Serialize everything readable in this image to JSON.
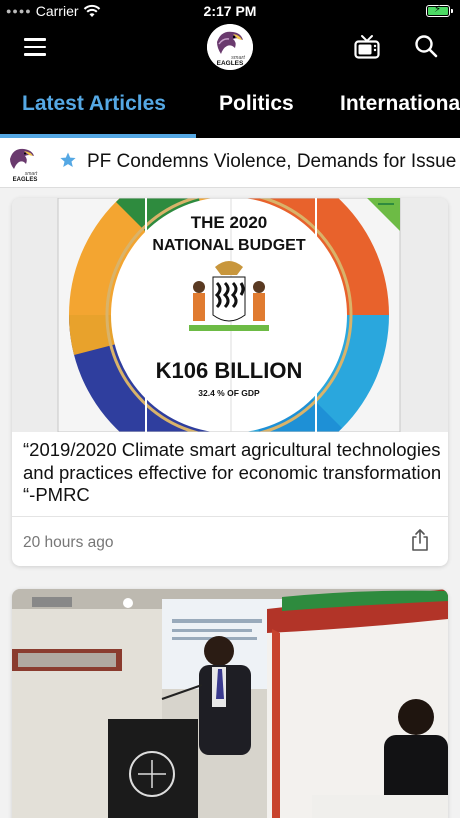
{
  "status_bar": {
    "carrier": "Carrier",
    "time": "2:17 PM"
  },
  "header": {
    "logo_small_text": "smart",
    "logo_text": "EAGLES",
    "icons": [
      "menu-icon",
      "tv-icon",
      "search-icon"
    ]
  },
  "tabs": [
    {
      "label": "Latest Articles",
      "active": true
    },
    {
      "label": "Politics",
      "active": false
    },
    {
      "label": "Internationa",
      "active": false
    }
  ],
  "ticker": {
    "text": "PF Condemns Violence, Demands for Issue B"
  },
  "articles": [
    {
      "image": {
        "line1": "THE 2020",
        "line2": "NATIONAL BUDGET",
        "amount": "K106 BILLION",
        "note": "32.4 % OF GDP"
      },
      "title": "“2019/2020 Climate smart agricultural technologies and practices effective for economic transformation “-PMRC",
      "time": "20 hours ago"
    },
    {
      "image": {}
    }
  ],
  "colors": {
    "accent": "#55a8e4",
    "header_bg": "#000000",
    "battery": "#4cd964"
  }
}
